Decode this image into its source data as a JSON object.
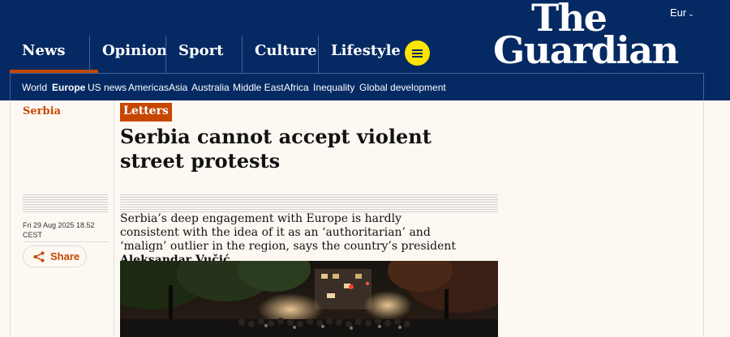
{
  "header": {
    "edition": "Eur",
    "logo_line1": "The",
    "logo_line2": "Guardian",
    "pillars": [
      {
        "label": "News",
        "active": true
      },
      {
        "label": "Opinion",
        "active": false
      },
      {
        "label": "Sport",
        "active": false
      },
      {
        "label": "Culture",
        "active": false
      },
      {
        "label": "Lifestyle",
        "active": false
      }
    ],
    "menu_icon": "hamburger-menu-icon",
    "subnav": [
      {
        "label": "World",
        "active": false
      },
      {
        "label": "Europe",
        "active": true
      },
      {
        "label": "US news",
        "active": false
      },
      {
        "label": "Americas",
        "active": false
      },
      {
        "label": "Asia",
        "active": false
      },
      {
        "label": "Australia",
        "active": false
      },
      {
        "label": "Middle East",
        "active": false
      },
      {
        "label": "Africa",
        "active": false
      },
      {
        "label": "Inequality",
        "active": false
      },
      {
        "label": "Global development",
        "active": false
      }
    ]
  },
  "article": {
    "section": "Serbia",
    "kicker": "Letters",
    "headline": "Serbia cannot accept violent street protests",
    "dateline": "Fri 29 Aug 2025 18.52 CEST",
    "standfirst_text": "Serbia’s deep engagement with Europe is hardly consistent with the idea of it as an ‘authoritarian’ and ‘malign’ outlier in the region, says the country’s president ",
    "author": "Aleksandar Vučić",
    "share_label": "Share",
    "share_icon": "share-icon"
  },
  "colors": {
    "brand_blue": "#052962",
    "news_accent": "#c74600",
    "menu_yellow": "#ffe500",
    "page_bg": "#fdf8f2"
  }
}
